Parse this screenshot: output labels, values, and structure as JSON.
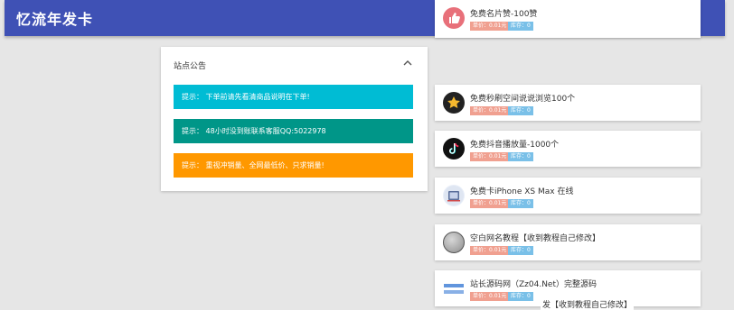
{
  "app": {
    "title": "忆流年发卡"
  },
  "notice": {
    "title": "站点公告",
    "alerts": [
      {
        "text": "提示： 下单前请先看清商品说明在下单!"
      },
      {
        "text": "提示： 48小时没到账联系客服QQ:5022978"
      },
      {
        "text": "提示： 重视冲销量、全网最低价、只求销量!"
      }
    ]
  },
  "products": [
    {
      "name": "免费名片赞-100赞",
      "price": "单价：0.01元",
      "stock": "库存：0",
      "icon": "thumbs-up-icon",
      "icon_color": "#e8707a"
    },
    {
      "name": "免费秒刷空间说说浏览100个",
      "price": "单价：0.01元",
      "stock": "库存：0",
      "icon": "star-icon",
      "icon_color": "#222222"
    },
    {
      "name": "免费抖音播放量-1000个",
      "price": "单价：0.01元",
      "stock": "库存：0",
      "icon": "tiktok-icon",
      "icon_color": "#111111"
    },
    {
      "name": "免费卡iPhone XS Max 在线",
      "price": "单价：0.01元",
      "stock": "库存：0",
      "icon": "iphone-icon",
      "icon_color": "#5a6e9a"
    },
    {
      "name": "空白网名教程【收到教程自己修改】",
      "price": "单价：0.01元",
      "stock": "库存：0",
      "icon": "blank-circle-icon",
      "icon_color": "#9e9e9e"
    },
    {
      "name": "站长源码网（Zz04.Net）完整源码",
      "price": "单价：0.01元",
      "stock": "库存：0",
      "icon": "site-logo-icon",
      "icon_color": "#3a7bd5"
    }
  ],
  "overflow_text": "发【收到教程自己修改】",
  "colors": {
    "topbar": "#3f51b5",
    "info": "#00bcd4",
    "success": "#009688",
    "warning": "#ff9800",
    "price_badge": "#f0a090",
    "stock_badge": "#7ac0e8"
  }
}
